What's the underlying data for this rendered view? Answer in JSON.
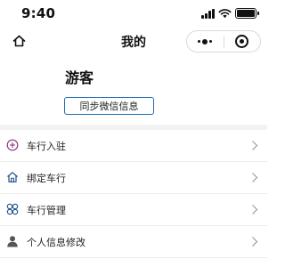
{
  "status_bar": {
    "time": "9:40"
  },
  "nav": {
    "title": "我的"
  },
  "profile": {
    "username": "游客",
    "sync_button": "同步微信信息"
  },
  "menu": {
    "items": [
      {
        "label": "车行入驻",
        "icon": "plus-circle-icon",
        "color": "#8a2b7a"
      },
      {
        "label": "绑定车行",
        "icon": "house-icon",
        "color": "#1d4f8c"
      },
      {
        "label": "车行管理",
        "icon": "clover-icon",
        "color": "#1d4f8c"
      },
      {
        "label": "个人信息修改",
        "icon": "person-icon",
        "color": "#555555"
      }
    ]
  },
  "colors": {
    "accent": "#1b6fb5",
    "divider": "#ececec",
    "section_gap": "#f2f2f2"
  }
}
